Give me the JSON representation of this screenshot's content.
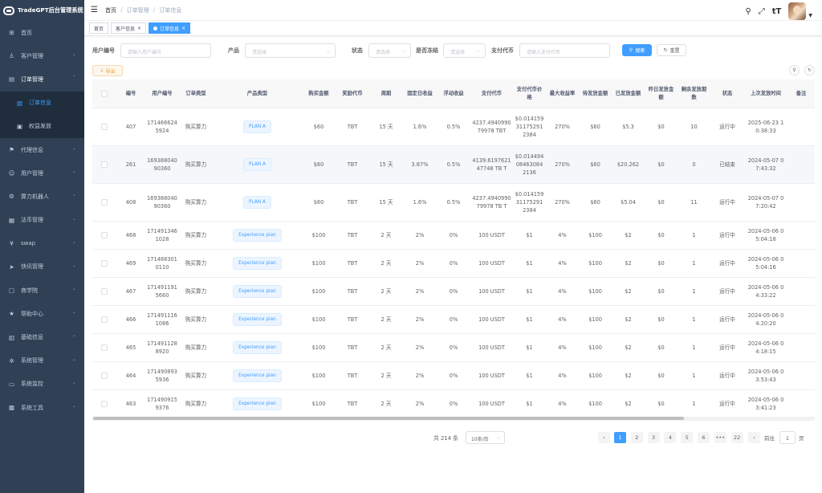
{
  "app": {
    "title": "TradeGPT后台管理系统"
  },
  "sidebar": {
    "items": [
      {
        "label": "首页",
        "icon": "dashboard-icon",
        "glyph": "⊞",
        "name": "home",
        "arrow": false
      },
      {
        "label": "客户管理",
        "icon": "customer-icon",
        "glyph": "♙",
        "name": "customer",
        "arrow": true
      },
      {
        "label": "订单管理",
        "icon": "order-icon",
        "glyph": "▤",
        "name": "order",
        "arrow": true,
        "open": true
      },
      {
        "label": "订单信息",
        "icon": "order-info-icon",
        "glyph": "▧",
        "name": "order-info",
        "sub": true,
        "active": true
      },
      {
        "label": "权益发放",
        "icon": "rights-icon",
        "glyph": "▣",
        "name": "rights",
        "sub": true
      },
      {
        "label": "代理信息",
        "icon": "agent-icon",
        "glyph": "⚑",
        "name": "agent",
        "arrow": true
      },
      {
        "label": "用户管理",
        "icon": "user-icon",
        "glyph": "☺",
        "name": "user",
        "arrow": true
      },
      {
        "label": "算力机器人",
        "icon": "robot-icon",
        "glyph": "⚙",
        "name": "robot",
        "arrow": true
      },
      {
        "label": "法币管理",
        "icon": "fiat-icon",
        "glyph": "▦",
        "name": "fiat",
        "arrow": true
      },
      {
        "label": "swap",
        "icon": "swap-icon",
        "glyph": "¥",
        "name": "swap",
        "arrow": true
      },
      {
        "label": "快讯管理",
        "icon": "news-icon",
        "glyph": "➤",
        "name": "news",
        "arrow": true
      },
      {
        "label": "商学院",
        "icon": "school-icon",
        "glyph": "▢",
        "name": "school",
        "arrow": true
      },
      {
        "label": "帮助中心",
        "icon": "help-icon",
        "glyph": "★",
        "name": "help",
        "arrow": true
      },
      {
        "label": "基础信息",
        "icon": "base-info-icon",
        "glyph": "▥",
        "name": "base-info",
        "arrow": true
      },
      {
        "label": "系统管理",
        "icon": "system-icon",
        "glyph": "✲",
        "name": "system",
        "arrow": true
      },
      {
        "label": "系统监控",
        "icon": "monitor-icon",
        "glyph": "▭",
        "name": "monitor",
        "arrow": true
      },
      {
        "label": "系统工具",
        "icon": "tools-icon",
        "glyph": "▩",
        "name": "tools",
        "arrow": true
      }
    ]
  },
  "navbar": {
    "breadcrumb": [
      "首页",
      "订单管理",
      "订单信息"
    ]
  },
  "tags": [
    {
      "label": "首页",
      "active": false,
      "close": false
    },
    {
      "label": "客户信息",
      "active": false,
      "close": true
    },
    {
      "label": "订单信息",
      "active": true,
      "close": true
    }
  ],
  "filters": {
    "user_no_label": "用户编号",
    "user_no_placeholder": "请输入用户编号",
    "product_label": "产品",
    "product_placeholder": "请选择",
    "status_label": "状态",
    "status_placeholder": "请选择",
    "frozen_label": "是否冻结",
    "frozen_placeholder": "请选择",
    "coin_label": "支付代币",
    "coin_placeholder": "请输入支付代币",
    "search_label": "搜索",
    "reset_label": "重置"
  },
  "toolbar": {
    "export_label": "导出"
  },
  "table": {
    "headers": [
      "编号",
      "用户编号",
      "订单类型",
      "产品类型",
      "购买金额",
      "奖励代币",
      "周期",
      "固定日收益",
      "浮动收益",
      "支付代币",
      "支付代币价格",
      "最大收益率",
      "待发放金额",
      "已发放金额",
      "昨日发放金额",
      "剩余发放期数",
      "状态",
      "上次发放时间",
      "备注"
    ],
    "rows": [
      [
        "407",
        "1714666245924",
        "购买算力",
        "PLAN A",
        "$60",
        "TBT",
        "15 天",
        "1.6%",
        "0.5%",
        "4237.494099079978 TBT",
        "$0.014159311752912384",
        "270%",
        "$60",
        "$5.3",
        "$0",
        "10",
        "运行中",
        "2025-06-23 10:38:33",
        ""
      ],
      [
        "261",
        "1693880409036​0",
        "购买算力",
        "PLAN A",
        "$60",
        "TBT",
        "15 天",
        "3.87%",
        "0.5%",
        "4139.619762147748 TB T",
        "$0.014494084630842136",
        "270%",
        "$60",
        "$20.262",
        "$0",
        "0",
        "已结束",
        "2024-05-07 07:43:32",
        ""
      ],
      [
        "408",
        "16938804090360",
        "购买算力",
        "PLAN A",
        "$60",
        "TBT",
        "15 天",
        "1.6%",
        "0.5%",
        "4237.494099079978 TB T",
        "$0.014159311752912384",
        "270%",
        "$60",
        "$5.04",
        "$0",
        "11",
        "运行中",
        "2024-05-07 07:20:42",
        ""
      ],
      [
        "468",
        "1714913461028",
        "购买算力",
        "Experience plan",
        "$100",
        "TBT",
        "2 天",
        "2%",
        "0%",
        "100 USDT",
        "$1",
        "4%",
        "$100",
        "$2",
        "$0",
        "1",
        "运行中",
        "2024-05-06 05:04:18",
        ""
      ],
      [
        "469",
        "1714883010110",
        "购买算力",
        "Experience plan",
        "$100",
        "TBT",
        "2 天",
        "2%",
        "0%",
        "100 USDT",
        "$1",
        "4%",
        "$100",
        "$2",
        "$0",
        "1",
        "运行中",
        "2024-05-06 05:04:16",
        ""
      ],
      [
        "467",
        "1714911915660",
        "购买算力",
        "Experience plan",
        "$100",
        "TBT",
        "2 天",
        "2%",
        "0%",
        "100 USDT",
        "$1",
        "4%",
        "$100",
        "$2",
        "$0",
        "1",
        "运行中",
        "2024-05-06 04:33:22",
        ""
      ],
      [
        "466",
        "1714911161086",
        "购买算力",
        "Experience plan",
        "$100",
        "TBT",
        "2 天",
        "2%",
        "0%",
        "100 USDT",
        "$1",
        "4%",
        "$100",
        "$2",
        "$0",
        "1",
        "运行中",
        "2024-05-06 04:20:20",
        ""
      ],
      [
        "465",
        "1714911288920",
        "购买算力",
        "Experience plan",
        "$100",
        "TBT",
        "2 天",
        "2%",
        "0%",
        "100 USDT",
        "$1",
        "4%",
        "$100",
        "$2",
        "$0",
        "1",
        "运行中",
        "2024-05-06 04:18:15",
        ""
      ],
      [
        "464",
        "1714908935936",
        "购买算力",
        "Experience plan",
        "$100",
        "TBT",
        "2 天",
        "2%",
        "0%",
        "100 USDT",
        "$1",
        "4%",
        "$100",
        "$2",
        "$0",
        "1",
        "运行中",
        "2024-05-06 03:53:43",
        ""
      ],
      [
        "463",
        "1714909159376",
        "购买算力",
        "Experience plan",
        "$100",
        "TBT",
        "2 天",
        "2%",
        "0%",
        "100 USDT",
        "$1",
        "4%",
        "$100",
        "$2",
        "$0",
        "1",
        "运行中",
        "2024-05-06 03:41:23",
        ""
      ]
    ]
  },
  "pagination": {
    "total": "共 214 条",
    "page_size": "10条/页",
    "pages": [
      "1",
      "2",
      "3",
      "4",
      "5",
      "6",
      "•••",
      "22"
    ],
    "current": "1",
    "jump_prefix": "前往",
    "jump_value": "1",
    "jump_suffix": "页"
  },
  "colors": {
    "primary": "#409eff",
    "sidebar": "#304156",
    "warning": "#e6a23c"
  }
}
